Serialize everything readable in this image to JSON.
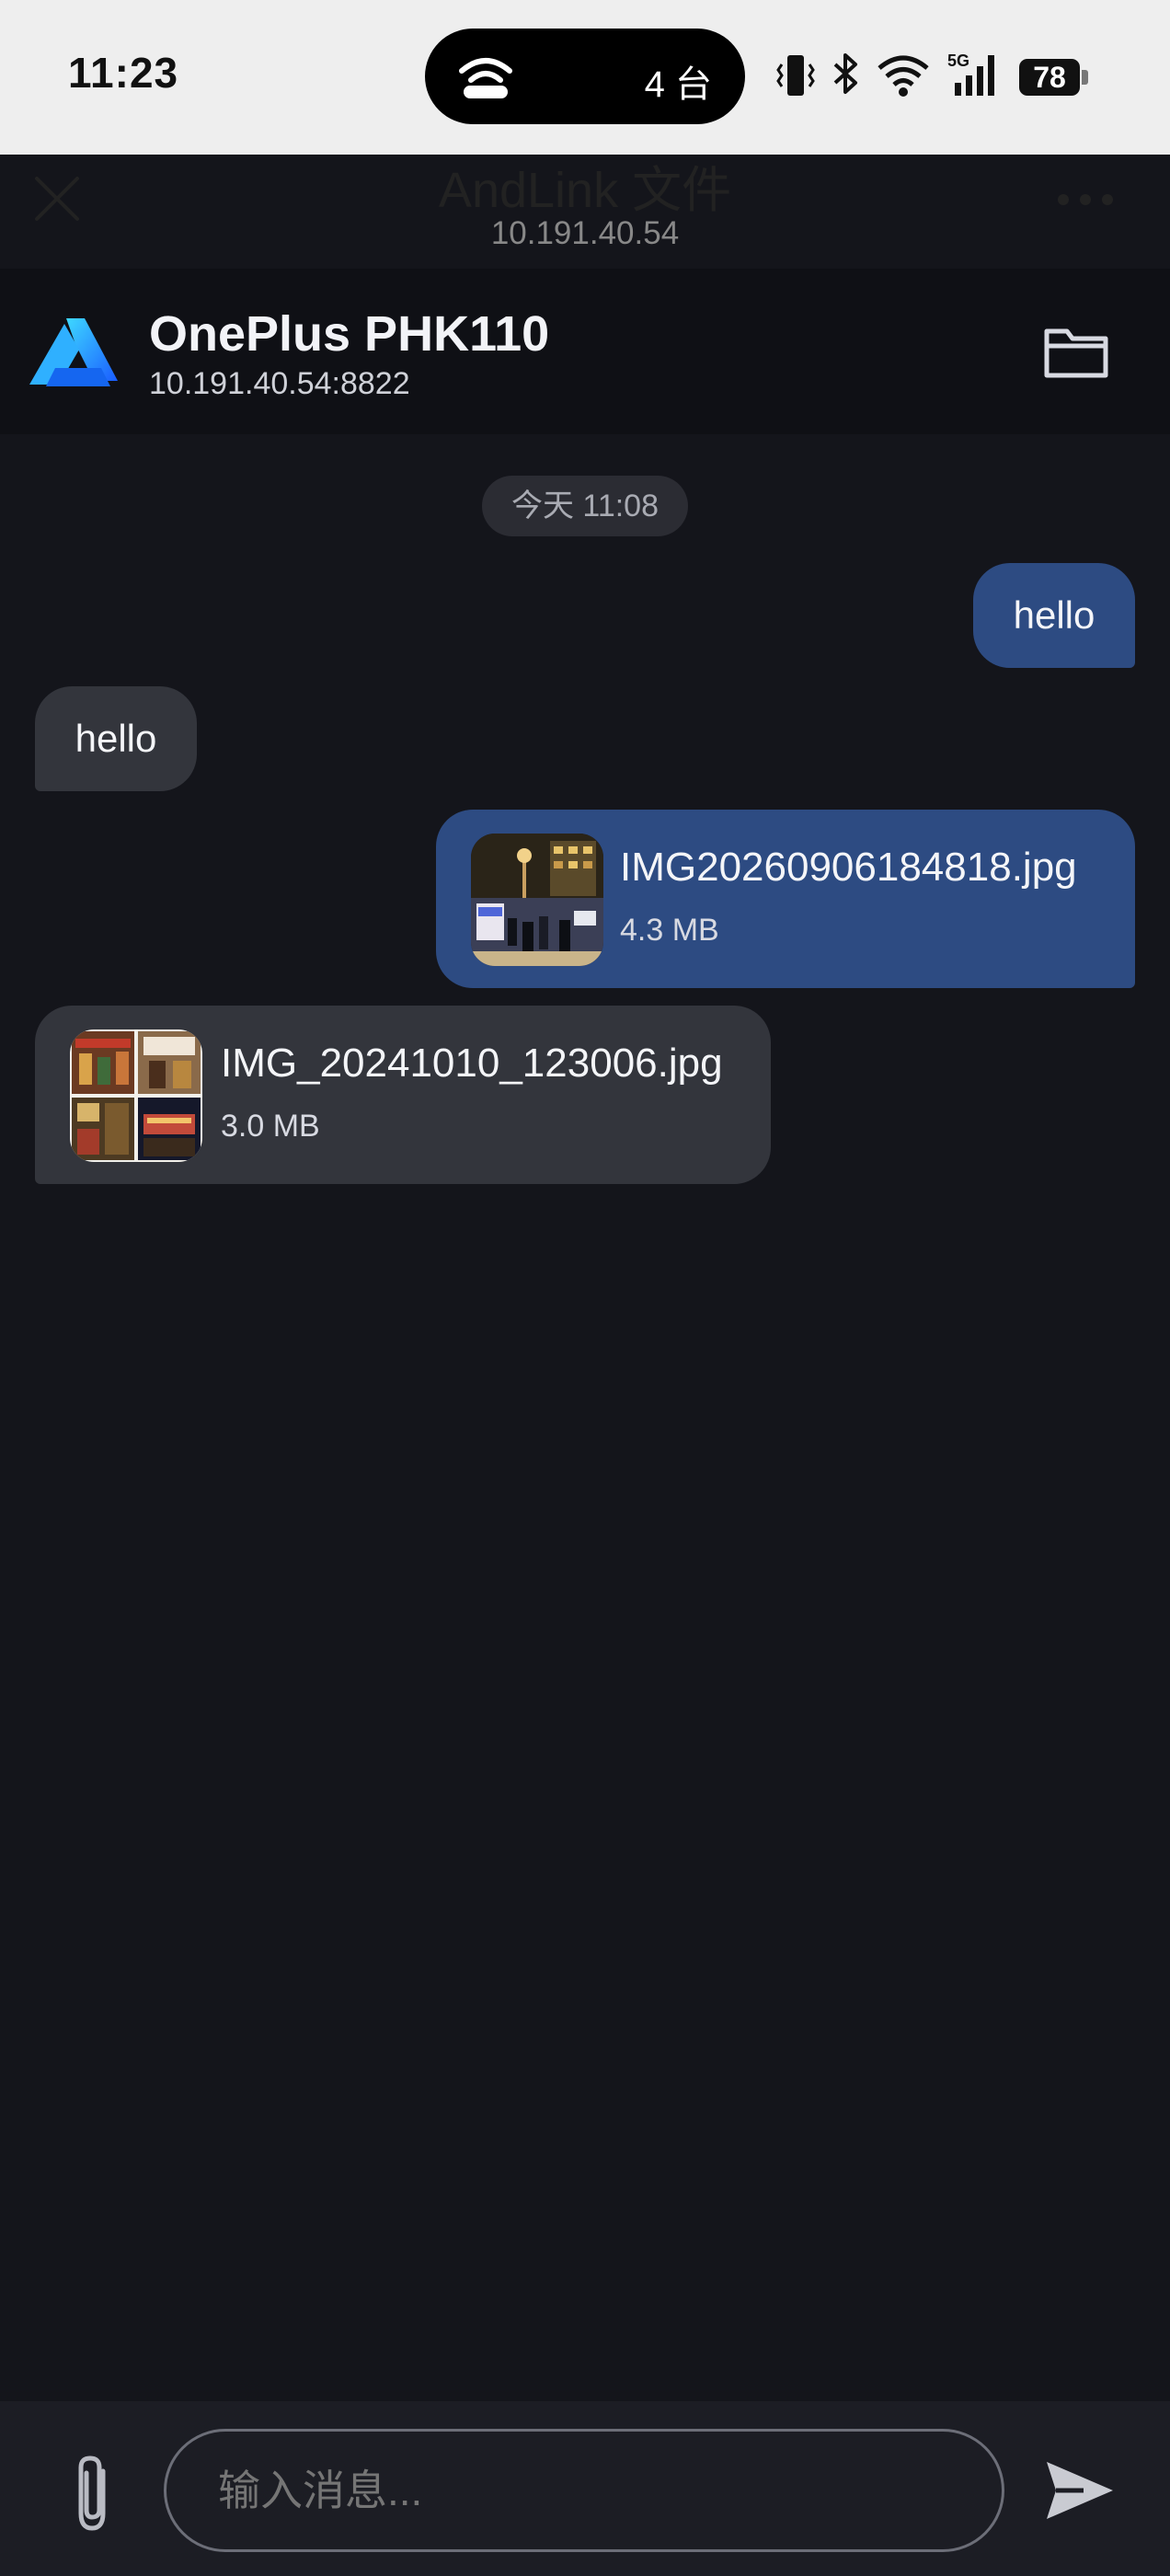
{
  "status_bar": {
    "time": "11:23",
    "island_count": "4 台",
    "network_label": "5G",
    "battery": "78"
  },
  "titlebar": {
    "title": "AndLink 文件",
    "subtitle": "10.191.40.54"
  },
  "device": {
    "name": "OnePlus PHK110",
    "address": "10.191.40.54:8822"
  },
  "chat": {
    "date_label": "今天 11:08",
    "messages": [
      {
        "direction": "out",
        "type": "text",
        "text": "hello"
      },
      {
        "direction": "in",
        "type": "text",
        "text": "hello"
      },
      {
        "direction": "out",
        "type": "file",
        "filename": "IMG20260906184818.jpg",
        "size": "4.3 MB"
      },
      {
        "direction": "in",
        "type": "file",
        "filename": "IMG_20241010_123006.jpg",
        "size": "3.0 MB"
      }
    ]
  },
  "composer": {
    "placeholder": "输入消息..."
  },
  "colors": {
    "outgoing_bubble": "#2d4b82",
    "incoming_bubble": "#33353c",
    "background": "#14151b",
    "accent": "#1e9bff"
  },
  "icons": [
    "close-icon",
    "more-icon",
    "app-logo-icon",
    "folder-icon",
    "attach-icon",
    "send-icon",
    "wifi-icon",
    "bluetooth-icon",
    "vibrate-icon",
    "signal-icon",
    "hotspot-icon"
  ]
}
